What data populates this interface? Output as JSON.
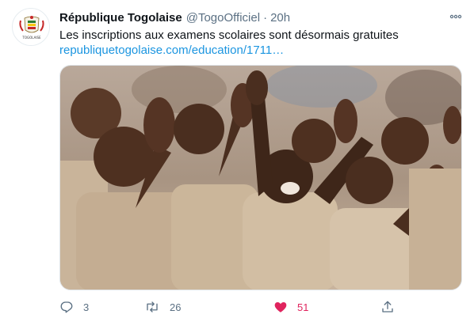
{
  "tweet": {
    "author_name": "République Togolaise",
    "author_handle": "@TogoOfficiel",
    "separator": "·",
    "time": "20h",
    "text": "Les inscriptions aux examens scolaires sont désormais gratuites",
    "link": "republiquetogolaise.com/education/1711…",
    "avatar_caption": "TOGOLAISE",
    "image_subject": "children cheering with raised hands"
  },
  "actions": {
    "reply": {
      "icon": "reply-icon",
      "count": "3"
    },
    "retweet": {
      "icon": "retweet-icon",
      "count": "26"
    },
    "like": {
      "icon": "heart-icon",
      "count": "51",
      "liked": true,
      "color": "#e0245e"
    },
    "share": {
      "icon": "share-icon"
    }
  },
  "colors": {
    "text": "#0f1419",
    "secondary": "#5b7083",
    "link": "#1b95e0",
    "like": "#e0245e"
  }
}
